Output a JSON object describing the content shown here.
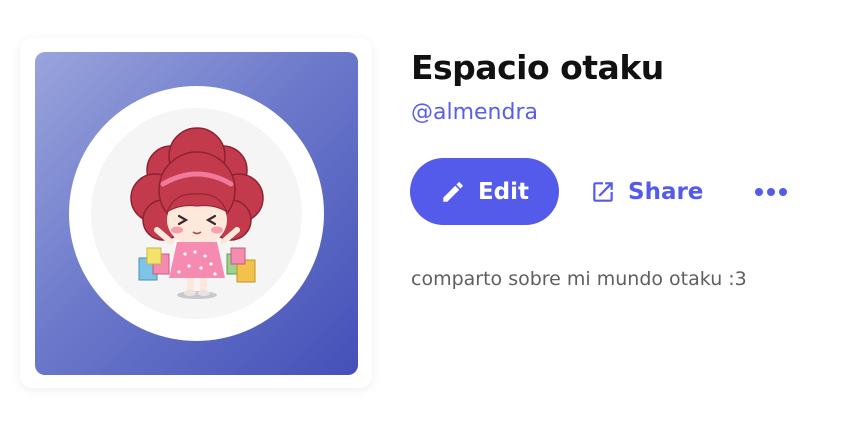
{
  "profile": {
    "title": "Espacio otaku",
    "handle": "@almendra",
    "bio": "comparto sobre mi mundo otaku :3"
  },
  "actions": {
    "edit_label": "Edit",
    "share_label": "Share",
    "more_icon": "more-horizontal-icon",
    "edit_icon": "pencil-icon",
    "share_icon": "external-link-icon"
  },
  "avatar": {
    "description_icon": "cartoon-girl-shopping-bags"
  },
  "colors": {
    "accent": "#545ae9",
    "cover_gradient_start": "#9aa4dc",
    "cover_gradient_end": "#4450b8",
    "title": "#111111",
    "bio": "#5f5f5f"
  }
}
